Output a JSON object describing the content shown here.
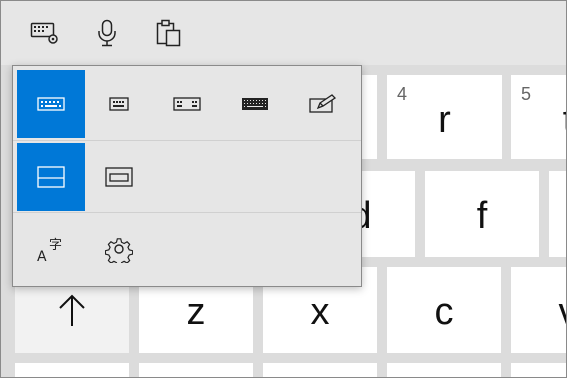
{
  "toolbar": {
    "items": [
      {
        "name": "keyboard-settings",
        "icon": "keyboard-settings-icon"
      },
      {
        "name": "voice-typing",
        "icon": "microphone-icon"
      },
      {
        "name": "clipboard",
        "icon": "clipboard-icon"
      }
    ]
  },
  "keyboard": {
    "row1": [
      {
        "number": "4",
        "letter": "r"
      },
      {
        "number": "5",
        "letter": "t"
      }
    ],
    "row2": [
      {
        "letter": "d"
      },
      {
        "letter": "f"
      }
    ],
    "row3": [
      {
        "letter": "z"
      },
      {
        "letter": "x"
      },
      {
        "letter": "c"
      },
      {
        "letter": "v"
      }
    ],
    "shift_icon": "arrow-up-icon"
  },
  "layout_menu": {
    "layouts": [
      {
        "name": "default-keyboard",
        "icon": "default-keyboard-icon",
        "selected": true
      },
      {
        "name": "one-handed-keyboard",
        "icon": "small-keyboard-icon",
        "selected": false
      },
      {
        "name": "split-keyboard",
        "icon": "split-keyboard-icon",
        "selected": false
      },
      {
        "name": "standard-keyboard",
        "icon": "full-keyboard-icon",
        "selected": false
      },
      {
        "name": "handwriting",
        "icon": "pen-icon",
        "selected": false
      }
    ],
    "dock_modes": [
      {
        "name": "docked",
        "icon": "docked-icon",
        "selected": true
      },
      {
        "name": "undocked",
        "icon": "undocked-icon",
        "selected": false
      }
    ],
    "options": [
      {
        "name": "language",
        "icon": "language-icon"
      },
      {
        "name": "settings",
        "icon": "gear-icon"
      }
    ]
  },
  "colors": {
    "accent": "#0078d7",
    "key": "#ffffff",
    "panel": "#e6e6e6"
  }
}
